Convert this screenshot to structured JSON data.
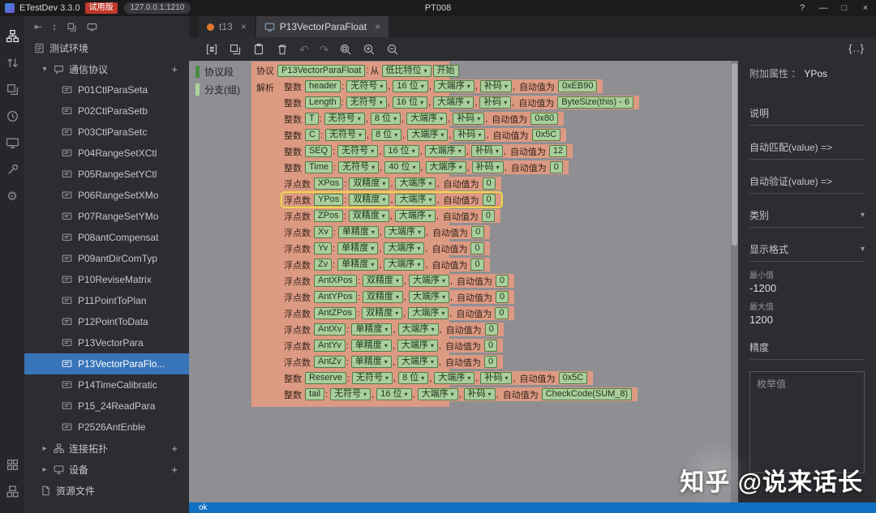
{
  "titlebar": {
    "app_title": "ETestDev 3.3.0",
    "trial_badge": "试用版",
    "address_badge": "127.0.0.1:1210",
    "window_title": "PT008"
  },
  "icons": {
    "chevron_down": "▾",
    "chevron_right": "▸",
    "plus": "+",
    "close": "×",
    "help": "?",
    "minimize": "—",
    "maximize": "□",
    "undo": "↶",
    "redo": "↷",
    "braces": "{..}",
    "gear": "⚙",
    "collapse_left": "⇤",
    "swap_vertical": "↕"
  },
  "tree": {
    "root": "测试环境",
    "groups": {
      "protocol_group": "通信协议",
      "topology_group": "连接拓扑",
      "device_group": "设备",
      "resource_group": "资源文件"
    },
    "protocols": [
      {
        "label": "P01CtlParaSeta"
      },
      {
        "label": "P02CtlParaSetb"
      },
      {
        "label": "P03CtlParaSetc"
      },
      {
        "label": "P04RangeSetXCtl"
      },
      {
        "label": "P05RangeSetYCtl"
      },
      {
        "label": "P06RangeSetXMo"
      },
      {
        "label": "P07RangeSetYMo"
      },
      {
        "label": "P08antCompensat"
      },
      {
        "label": "P09antDirComTyp"
      },
      {
        "label": "P10ReviseMatrix"
      },
      {
        "label": "P11PointToPlan"
      },
      {
        "label": "P12PointToData"
      },
      {
        "label": "P13VectorPara"
      },
      {
        "label": "P13VectorParaFlo...",
        "selected": true
      },
      {
        "label": "P14TimeCalibratic"
      },
      {
        "label": "P15_24ReadPara"
      },
      {
        "label": "P2526AntEnble"
      }
    ]
  },
  "tabs": [
    {
      "label": "t13",
      "active": false
    },
    {
      "label": "P13VectorParaFloat",
      "active": true
    }
  ],
  "legend": {
    "segment": "协议段",
    "branch": "分支(组)"
  },
  "editor": {
    "header": {
      "keyword": "协议",
      "name": "P13VectorParaFloat",
      "colon": " : ",
      "from": "从",
      "bit_order": "低比特位",
      "start": "开始"
    },
    "parse_label": "解析",
    "auto_label": "自动值为",
    "rows": [
      {
        "kind": "整数",
        "name": "header",
        "attrs": [
          "无符号",
          "16 位",
          "大端序",
          "补码"
        ],
        "value": "0xEB90"
      },
      {
        "kind": "整数",
        "name": "Length",
        "attrs": [
          "无符号",
          "16 位",
          "大端序",
          "补码"
        ],
        "value": "ByteSize(this) - 6"
      },
      {
        "kind": "整数",
        "name": "T",
        "attrs": [
          "无符号",
          "8 位",
          "大端序",
          "补码"
        ],
        "value": "0x80"
      },
      {
        "kind": "整数",
        "name": "C",
        "attrs": [
          "无符号",
          "8 位",
          "大端序",
          "补码"
        ],
        "value": "0x5C"
      },
      {
        "kind": "整数",
        "name": "SEQ",
        "attrs": [
          "无符号",
          "16 位",
          "大端序",
          "补码"
        ],
        "value": "12"
      },
      {
        "kind": "整数",
        "name": "Time",
        "attrs": [
          "无符号",
          "40 位",
          "大端序",
          "补码"
        ],
        "value": "0"
      },
      {
        "kind": "浮点数",
        "name": "XPos",
        "attrs": [
          "双精度",
          "大端序"
        ],
        "value": "0"
      },
      {
        "kind": "浮点数",
        "name": "YPos",
        "attrs": [
          "双精度",
          "大端序"
        ],
        "value": "0",
        "highlight": true
      },
      {
        "kind": "浮点数",
        "name": "ZPos",
        "attrs": [
          "双精度",
          "大端序"
        ],
        "value": "0"
      },
      {
        "kind": "浮点数",
        "name": "Xv",
        "attrs": [
          "单精度",
          "大端序"
        ],
        "value": "0"
      },
      {
        "kind": "浮点数",
        "name": "Yv",
        "attrs": [
          "单精度",
          "大端序"
        ],
        "value": "0"
      },
      {
        "kind": "浮点数",
        "name": "Zv",
        "attrs": [
          "单精度",
          "大端序"
        ],
        "value": "0"
      },
      {
        "kind": "浮点数",
        "name": "AntXPos",
        "attrs": [
          "双精度",
          "大端序"
        ],
        "value": "0"
      },
      {
        "kind": "浮点数",
        "name": "AntYPos",
        "attrs": [
          "双精度",
          "大端序"
        ],
        "value": "0"
      },
      {
        "kind": "浮点数",
        "name": "AntZPos",
        "attrs": [
          "双精度",
          "大端序"
        ],
        "value": "0"
      },
      {
        "kind": "浮点数",
        "name": "AntXv",
        "attrs": [
          "单精度",
          "大端序"
        ],
        "value": "0"
      },
      {
        "kind": "浮点数",
        "name": "AntYv",
        "attrs": [
          "单精度",
          "大端序"
        ],
        "value": "0"
      },
      {
        "kind": "浮点数",
        "name": "AntZv",
        "attrs": [
          "单精度",
          "大端序"
        ],
        "value": "0"
      },
      {
        "kind": "整数",
        "name": "Reserve",
        "attrs": [
          "无符号",
          "8 位",
          "大端序",
          "补码"
        ],
        "value": "0x5C"
      },
      {
        "kind": "整数",
        "name": "tail",
        "attrs": [
          "无符号",
          "16 位",
          "大端序",
          "补码"
        ],
        "value": "CheckCode(SUM_8)"
      }
    ]
  },
  "properties": {
    "title_label": "附加属性 ：",
    "title_value": "YPos",
    "sections": {
      "description": "说明",
      "auto_match": "自动匹配(value) =>",
      "auto_verify": "自动验证(value) =>",
      "category": "类别",
      "display_format": "显示格式",
      "min_label": "最小值",
      "min_value": "-1200",
      "max_label": "最大值",
      "max_value": "1200",
      "precision": "精度",
      "enum_placeholder": "枚举值"
    }
  },
  "statusbar": {
    "message": "ok"
  },
  "watermark": {
    "text": "知乎 @说来话长"
  },
  "colors": {
    "selection_blue": "#3874b8",
    "status_bar_blue": "#1070c2",
    "trial_badge_red": "#c0392b",
    "block_salmon": "#dd9a83",
    "chip_green": "#aace9d",
    "chip_border_green": "#4f7d45",
    "highlight_yellow": "#ecd74b"
  }
}
